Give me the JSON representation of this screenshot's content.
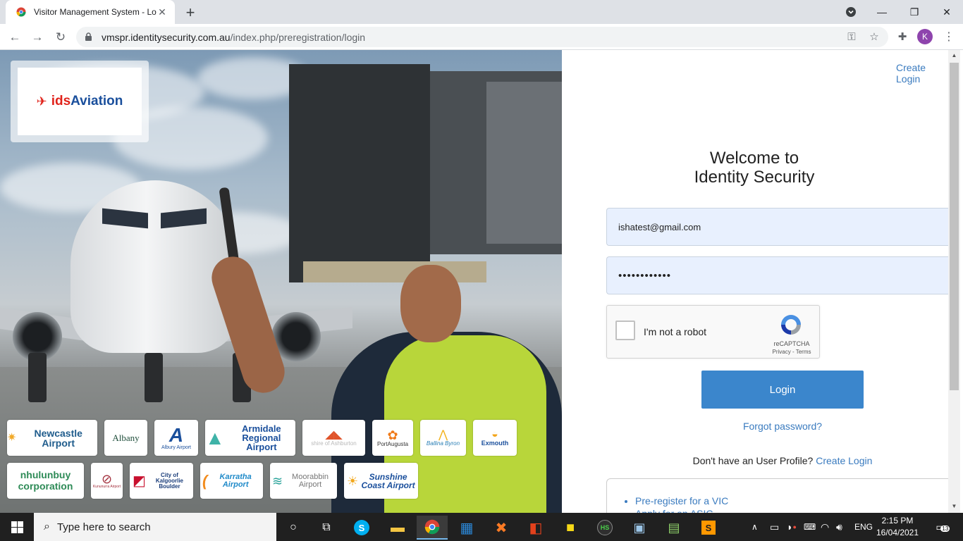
{
  "browser": {
    "tab_title": "Visitor Management System - Lo",
    "url_host": "vmspr.identitysecurity.com.au",
    "url_path": "/index.php/preregistration/login",
    "profile_initial": "K"
  },
  "hero": {
    "logo_ids": "ids",
    "logo_aviation": "Aviation",
    "partners": [
      {
        "label": "Newcastle Airport"
      },
      {
        "label": "Albany"
      },
      {
        "label": "Albury Airport"
      },
      {
        "label": "Armidale Regional Airport"
      },
      {
        "label": "shire of Ashburton"
      },
      {
        "label": "PortAugusta"
      },
      {
        "label": "Ballina Byron"
      },
      {
        "label": "Exmouth"
      },
      {
        "label": "nhulunbuy corporation"
      },
      {
        "label": "Kununurra Airport"
      },
      {
        "label": "City of Kalgoorlie Boulder"
      },
      {
        "label": "Karratha Airport"
      },
      {
        "label": "Moorabbin Airport"
      },
      {
        "label": "Sunshine Coast Airport"
      }
    ]
  },
  "login": {
    "create_login_top": "Create Login",
    "welcome_line1": "Welcome to",
    "welcome_line2": "Identity Security",
    "email_value": "ishatest@gmail.com",
    "password_mask": "••••••••••••",
    "captcha_label": "I'm not a robot",
    "captcha_brand": "reCAPTCHA",
    "captcha_links": "Privacy - Terms",
    "login_button": "Login",
    "forgot_password": "Forgot password?",
    "no_profile_text": "Don't have an User Profile?",
    "create_login_link": "Create Login",
    "links": [
      "Pre-register for a VIC",
      "Apply for an ASIC"
    ]
  },
  "taskbar": {
    "search_placeholder": "Type here to search",
    "language": "ENG",
    "time": "2:15 PM",
    "date": "16/04/2021",
    "notification_count": "13"
  },
  "colors": {
    "link": "#3a7bbf",
    "login_button": "#3b86cc",
    "input_bg": "#e8f0fe",
    "brand_red": "#e0231b",
    "brand_blue": "#1a4f9c"
  }
}
